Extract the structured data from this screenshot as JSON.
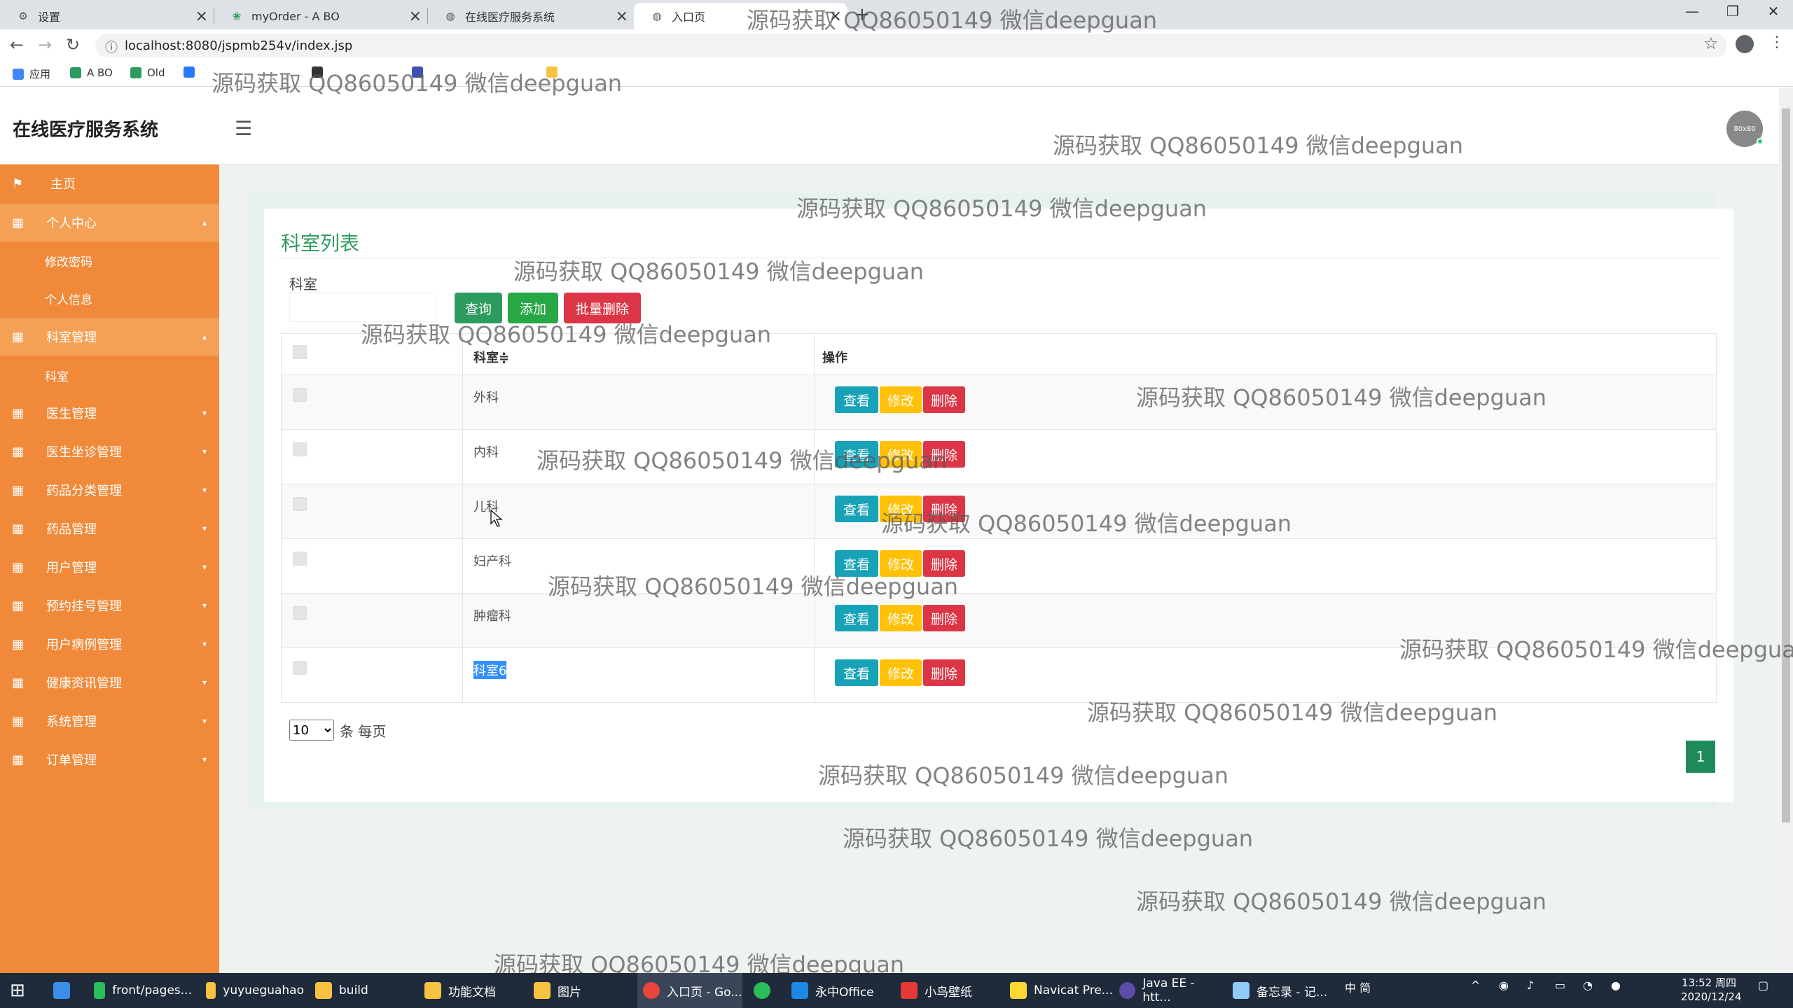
{
  "browser": {
    "tabs": [
      {
        "label": "设置",
        "icon": "gear-icon"
      },
      {
        "label": "myOrder - A BO",
        "icon": "leaf-icon"
      },
      {
        "label": "在线医疗服务系统",
        "icon": "globe-icon"
      },
      {
        "label": "入口页",
        "icon": "globe-icon"
      }
    ],
    "url": "localhost:8080/jspmb254v/index.jsp",
    "bookmarks": [
      "应用",
      "A BO",
      "Old"
    ]
  },
  "app": {
    "title": "在线医疗服务系统",
    "avatar_text": "80x80"
  },
  "sidebar": {
    "items": [
      {
        "label": "主页",
        "icon": "flag-icon"
      },
      {
        "label": "个人中心",
        "icon": "grid-icon",
        "open": true
      },
      {
        "label": "修改密码",
        "sub": true
      },
      {
        "label": "个人信息",
        "sub": true
      },
      {
        "label": "科室管理",
        "icon": "grid-icon",
        "open": true
      },
      {
        "label": "科室",
        "sub": true
      },
      {
        "label": "医生管理",
        "icon": "grid-icon"
      },
      {
        "label": "医生坐诊管理",
        "icon": "grid-icon"
      },
      {
        "label": "药品分类管理",
        "icon": "grid-icon"
      },
      {
        "label": "药品管理",
        "icon": "grid-icon"
      },
      {
        "label": "用户管理",
        "icon": "grid-icon"
      },
      {
        "label": "预约挂号管理",
        "icon": "grid-icon"
      },
      {
        "label": "用户病例管理",
        "icon": "grid-icon"
      },
      {
        "label": "健康资讯管理",
        "icon": "grid-icon"
      },
      {
        "label": "系统管理",
        "icon": "grid-icon"
      },
      {
        "label": "订单管理",
        "icon": "grid-icon"
      }
    ]
  },
  "panel": {
    "title": "科室列表",
    "search_label": "科室",
    "search_value": "",
    "btn_query": "查询",
    "btn_add": "添加",
    "btn_batch_delete": "批量删除",
    "col_dept": "科室≑",
    "col_ops": "操作",
    "rows": [
      "外科",
      "内科",
      "儿科",
      "妇产科",
      "肿瘤科",
      "科室6"
    ],
    "act_view": "查看",
    "act_edit": "修改",
    "act_delete": "删除",
    "page_size": "10",
    "page_size_suffix": "条 每页",
    "current_page": "1"
  },
  "watermark": "源码获取 QQ86050149 微信deepguan",
  "taskbar": {
    "items": [
      "front/pages...",
      "yuyueguahao",
      "build",
      "功能文档",
      "图片",
      "入口页 - Go...",
      "永中Office",
      "小鸟壁纸",
      "Navicat Pre...",
      "Java EE - htt...",
      "备忘录 - 记..."
    ],
    "tray_text": "中 简",
    "time": "13:52 周四",
    "date": "2020/12/24"
  }
}
